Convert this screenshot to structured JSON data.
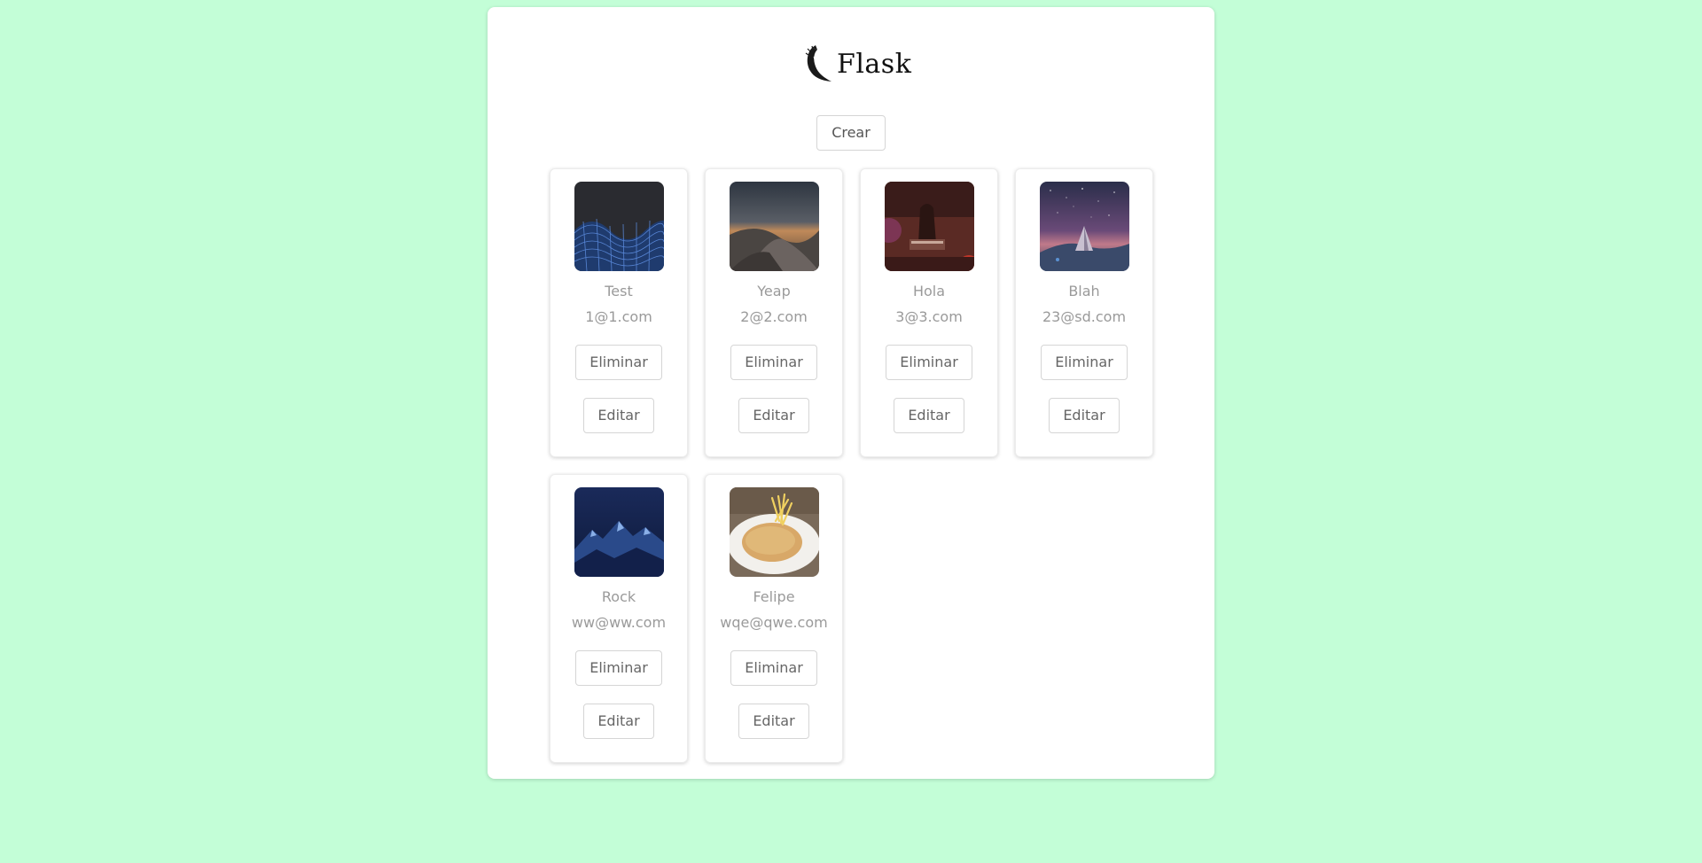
{
  "app": {
    "logo_text": "Flask"
  },
  "actions": {
    "create_label": "Crear"
  },
  "cards": [
    {
      "name": "Test",
      "email": "1@1.com",
      "delete_label": "Eliminar",
      "edit_label": "Editar",
      "image": "blue-wave-network"
    },
    {
      "name": "Yeap",
      "email": "2@2.com",
      "delete_label": "Eliminar",
      "edit_label": "Editar",
      "image": "desert-dunes-night"
    },
    {
      "name": "Hola",
      "email": "3@3.com",
      "delete_label": "Eliminar",
      "edit_label": "Editar",
      "image": "concert-stage"
    },
    {
      "name": "Blah",
      "email": "23@sd.com",
      "delete_label": "Eliminar",
      "edit_label": "Editar",
      "image": "starry-sky-tent"
    },
    {
      "name": "Rock",
      "email": "ww@ww.com",
      "delete_label": "Eliminar",
      "edit_label": "Editar",
      "image": "blue-mountains"
    },
    {
      "name": "Felipe",
      "email": "wqe@qwe.com",
      "delete_label": "Eliminar",
      "edit_label": "Editar",
      "image": "schnitzel-fries"
    }
  ],
  "colors": {
    "background": "#c3fed7",
    "panel": "#ffffff",
    "muted_text": "#9a9a9a"
  }
}
